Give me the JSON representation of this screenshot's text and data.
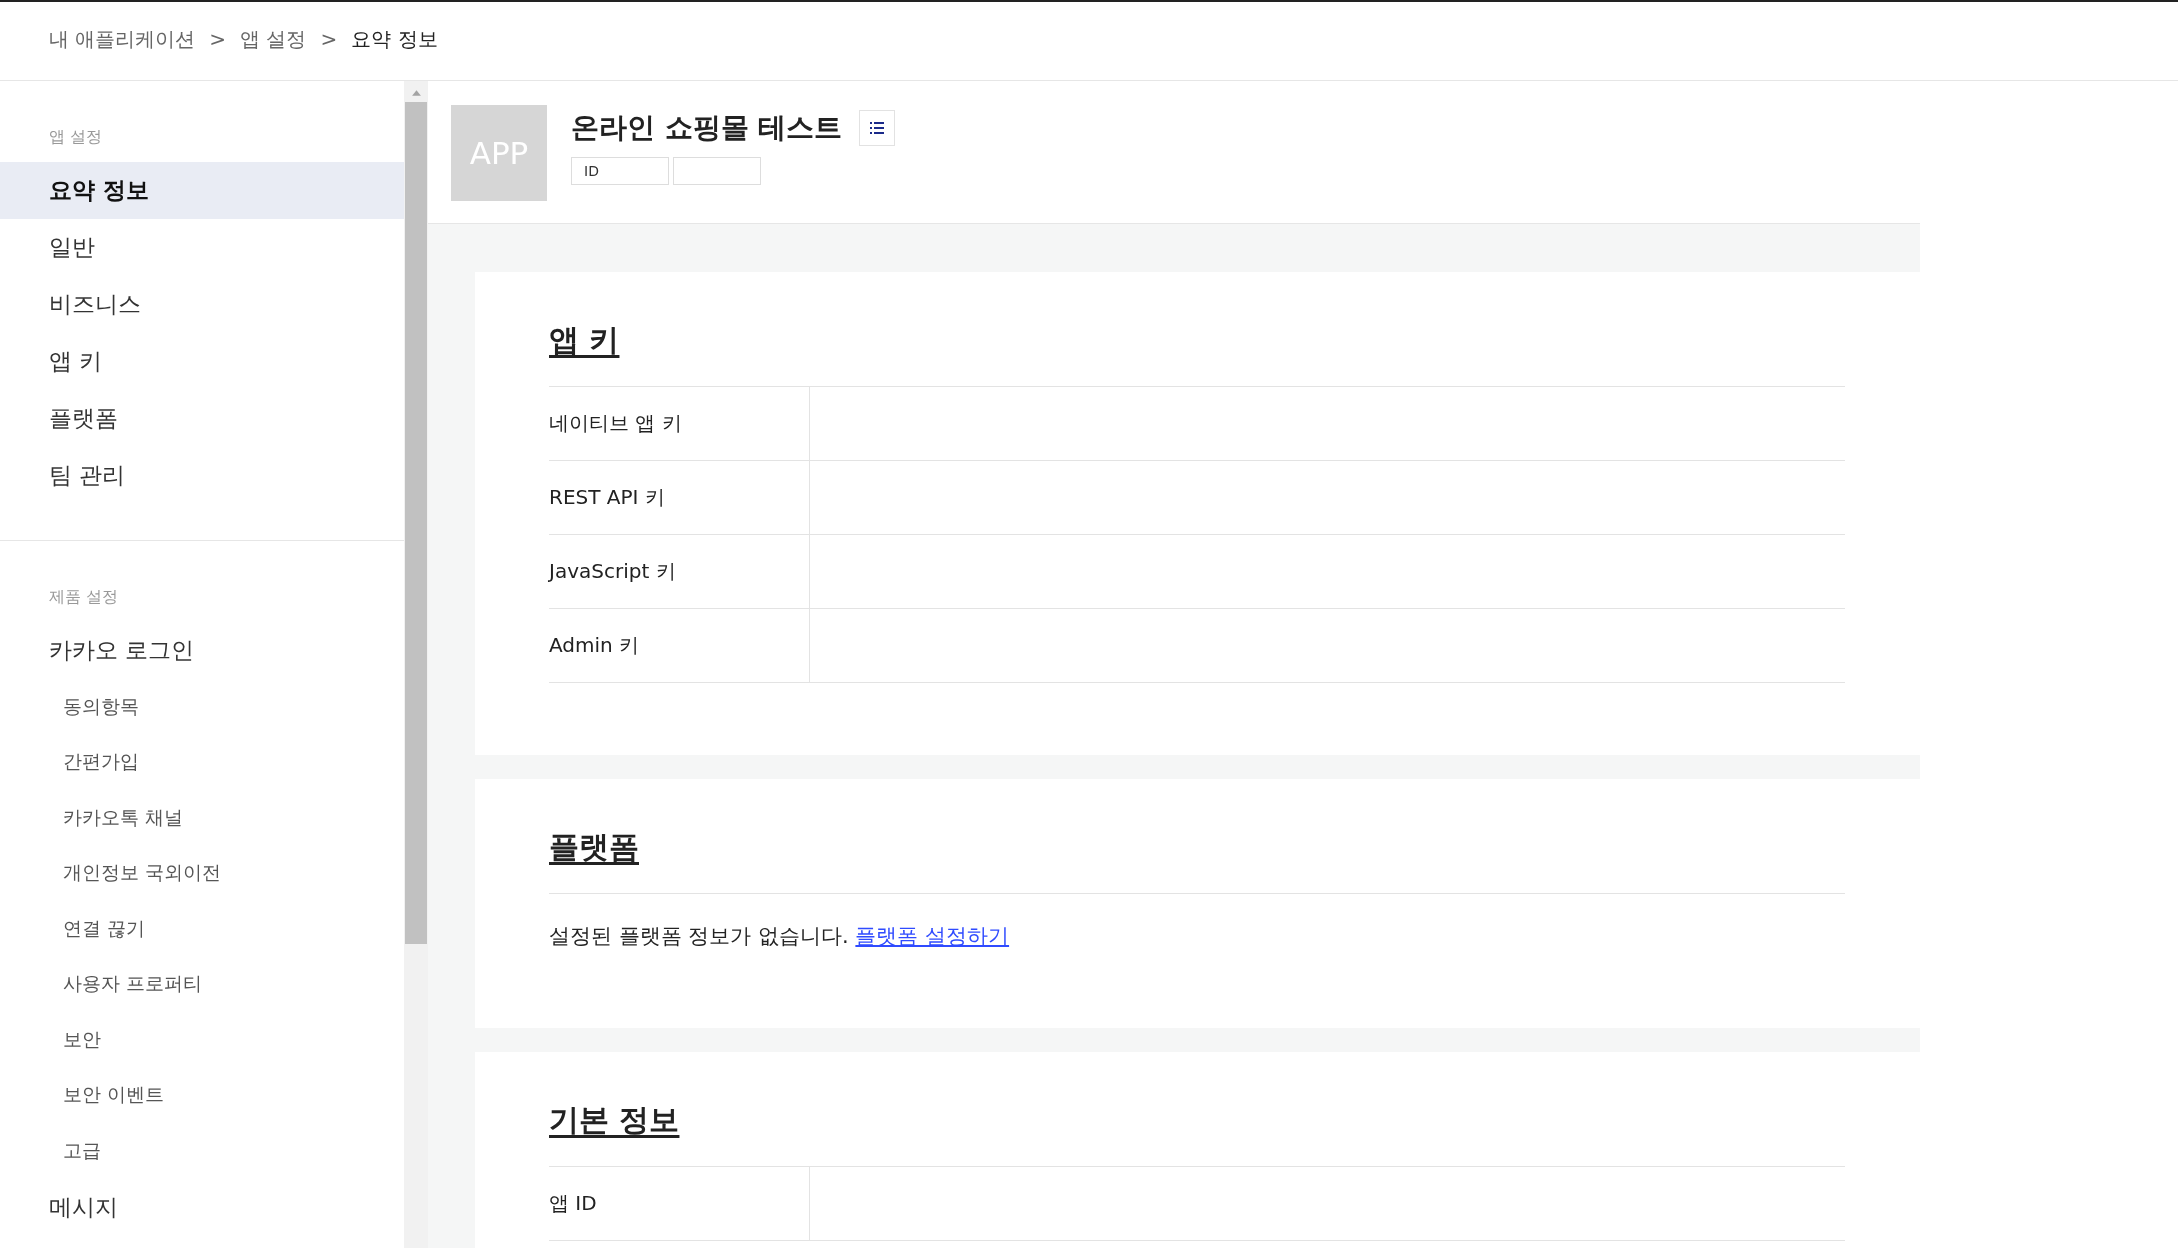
{
  "breadcrumb": [
    {
      "label": "내 애플리케이션",
      "current": false
    },
    {
      "label": "앱 설정",
      "current": false
    },
    {
      "label": "요약 정보",
      "current": true
    }
  ],
  "breadcrumb_separator": ">",
  "sidebar": {
    "sections": [
      {
        "title": "앱 설정",
        "items": [
          {
            "label": "요약 정보",
            "kind": "main",
            "selected": true
          },
          {
            "label": "일반",
            "kind": "main",
            "selected": false
          },
          {
            "label": "비즈니스",
            "kind": "main",
            "selected": false
          },
          {
            "label": "앱 키",
            "kind": "main",
            "selected": false
          },
          {
            "label": "플랫폼",
            "kind": "main",
            "selected": false
          },
          {
            "label": "팀 관리",
            "kind": "main",
            "selected": false
          }
        ]
      },
      {
        "title": "제품 설정",
        "items": [
          {
            "label": "카카오 로그인",
            "kind": "main",
            "selected": false
          },
          {
            "label": "동의항목",
            "kind": "sub",
            "selected": false
          },
          {
            "label": "간편가입",
            "kind": "sub",
            "selected": false
          },
          {
            "label": "카카오톡 채널",
            "kind": "sub",
            "selected": false
          },
          {
            "label": "개인정보 국외이전",
            "kind": "sub",
            "selected": false
          },
          {
            "label": "연결 끊기",
            "kind": "sub",
            "selected": false
          },
          {
            "label": "사용자 프로퍼티",
            "kind": "sub",
            "selected": false
          },
          {
            "label": "보안",
            "kind": "sub",
            "selected": false
          },
          {
            "label": "보안 이벤트",
            "kind": "sub",
            "selected": false
          },
          {
            "label": "고급",
            "kind": "sub",
            "selected": false
          },
          {
            "label": "메시지",
            "kind": "main",
            "selected": false
          }
        ]
      }
    ]
  },
  "app": {
    "logo": "APP",
    "name": "온라인 쇼핑몰 테스트",
    "id_label": "ID"
  },
  "sections": [
    {
      "title": "앱 키",
      "kind": "table",
      "rows": [
        {
          "label": "네이티브 앱 키"
        },
        {
          "label": "REST API 키"
        },
        {
          "label": "JavaScript 키"
        },
        {
          "label": "Admin 키"
        }
      ]
    },
    {
      "title": "플랫폼",
      "kind": "text",
      "text": "설정된 플랫폼 정보가 없습니다.",
      "link": "플랫폼 설정하기"
    },
    {
      "title": "기본 정보",
      "kind": "table",
      "rows": [
        {
          "label": "앱 ID"
        }
      ]
    }
  ]
}
